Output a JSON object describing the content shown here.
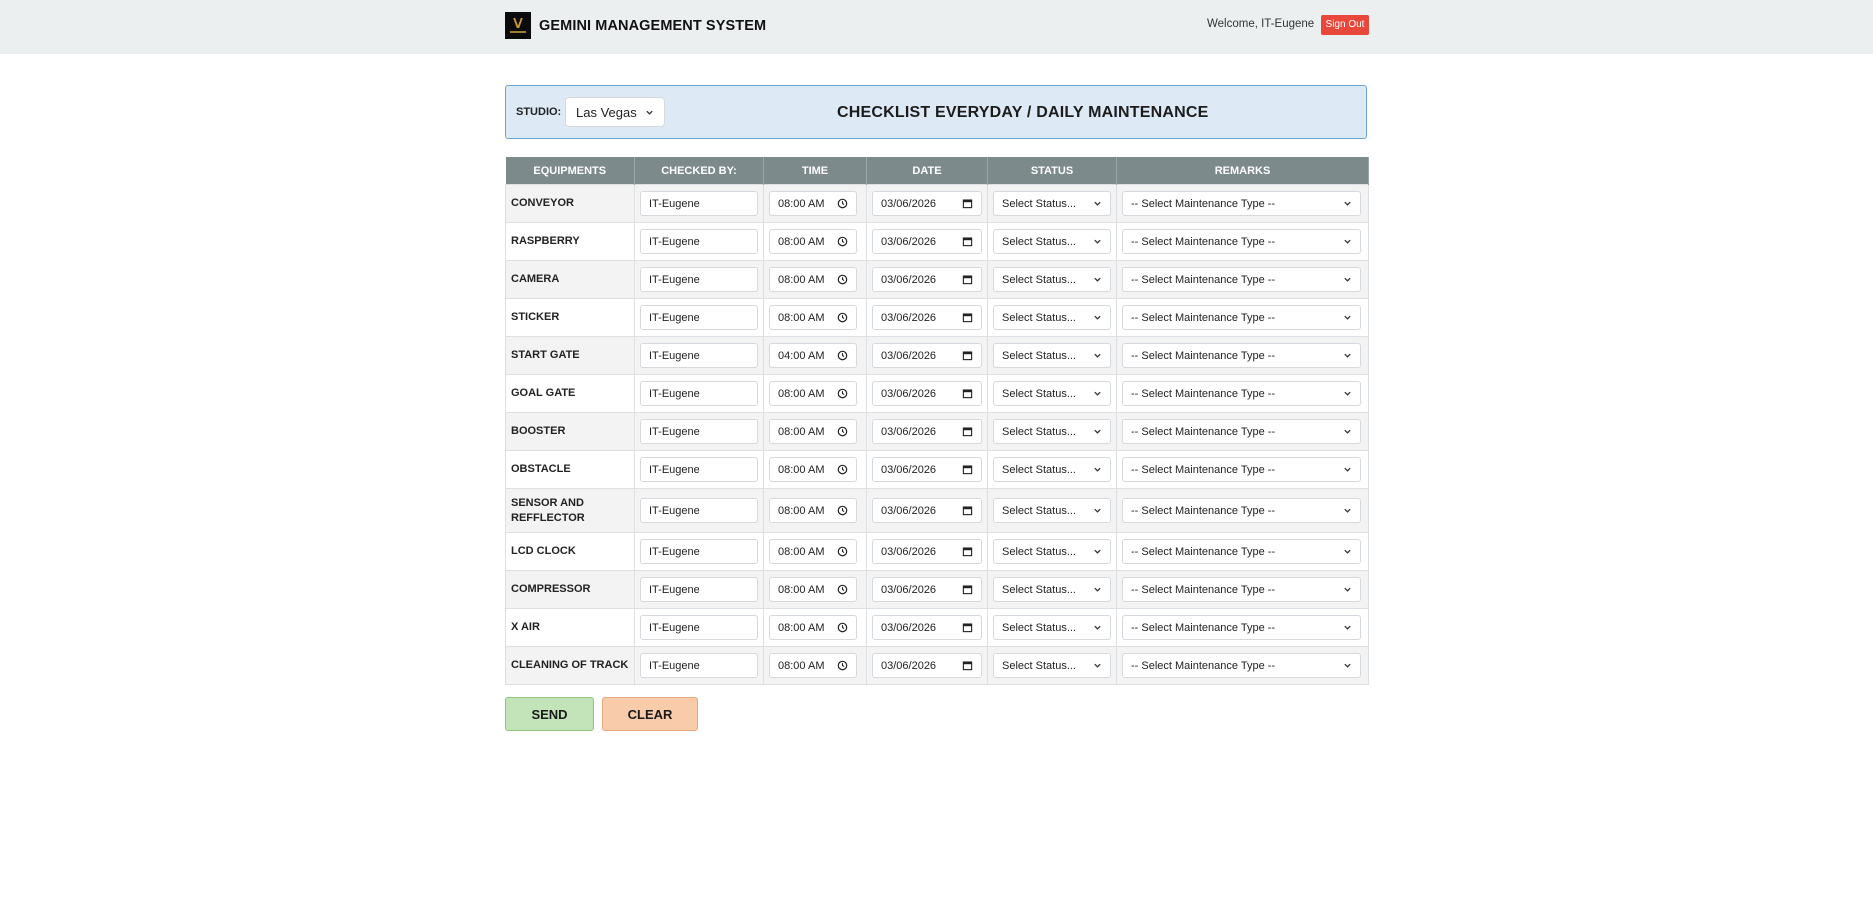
{
  "header": {
    "brand_title": "GEMINI MANAGEMENT SYSTEM",
    "welcome": "Welcome, IT-Eugene",
    "signout_label": "Sign Out",
    "logo_icon": "gemini-logo-icon"
  },
  "studio": {
    "label": "STUDIO:",
    "selected": "Las Vegas",
    "title": "CHECKLIST EVERYDAY / DAILY MAINTENANCE"
  },
  "table": {
    "columns": [
      "EQUIPMENTS",
      "CHECKED BY:",
      "TIME",
      "DATE",
      "STATUS",
      "REMARKS"
    ],
    "rows": [
      {
        "equipment": "CONVEYOR",
        "checked_by": "IT-Eugene",
        "time": "08:00 AM",
        "date": "03/06/2026",
        "status": "Select Status...",
        "remarks": "-- Select Maintenance Type --"
      },
      {
        "equipment": "RASPBERRY",
        "checked_by": "IT-Eugene",
        "time": "08:00 AM",
        "date": "03/06/2026",
        "status": "Select Status...",
        "remarks": "-- Select Maintenance Type --"
      },
      {
        "equipment": "CAMERA",
        "checked_by": "IT-Eugene",
        "time": "08:00 AM",
        "date": "03/06/2026",
        "status": "Select Status...",
        "remarks": "-- Select Maintenance Type --"
      },
      {
        "equipment": "STICKER",
        "checked_by": "IT-Eugene",
        "time": "08:00 AM",
        "date": "03/06/2026",
        "status": "Select Status...",
        "remarks": "-- Select Maintenance Type --"
      },
      {
        "equipment": "START GATE",
        "checked_by": "IT-Eugene",
        "time": "04:00 AM",
        "date": "03/06/2026",
        "status": "Select Status...",
        "remarks": "-- Select Maintenance Type --"
      },
      {
        "equipment": "GOAL GATE",
        "checked_by": "IT-Eugene",
        "time": "08:00 AM",
        "date": "03/06/2026",
        "status": "Select Status...",
        "remarks": "-- Select Maintenance Type --"
      },
      {
        "equipment": "BOOSTER",
        "checked_by": "IT-Eugene",
        "time": "08:00 AM",
        "date": "03/06/2026",
        "status": "Select Status...",
        "remarks": "-- Select Maintenance Type --"
      },
      {
        "equipment": "OBSTACLE",
        "checked_by": "IT-Eugene",
        "time": "08:00 AM",
        "date": "03/06/2026",
        "status": "Select Status...",
        "remarks": "-- Select Maintenance Type --"
      },
      {
        "equipment": "SENSOR AND REFFLECTOR",
        "checked_by": "IT-Eugene",
        "time": "08:00 AM",
        "date": "03/06/2026",
        "status": "Select Status...",
        "remarks": "-- Select Maintenance Type --"
      },
      {
        "equipment": "LCD CLOCK",
        "checked_by": "IT-Eugene",
        "time": "08:00 AM",
        "date": "03/06/2026",
        "status": "Select Status...",
        "remarks": "-- Select Maintenance Type --"
      },
      {
        "equipment": "COMPRESSOR",
        "checked_by": "IT-Eugene",
        "time": "08:00 AM",
        "date": "03/06/2026",
        "status": "Select Status...",
        "remarks": "-- Select Maintenance Type --"
      },
      {
        "equipment": "X AIR",
        "checked_by": "IT-Eugene",
        "time": "08:00 AM",
        "date": "03/06/2026",
        "status": "Select Status...",
        "remarks": "-- Select Maintenance Type --"
      },
      {
        "equipment": "CLEANING OF TRACK",
        "checked_by": "IT-Eugene",
        "time": "08:00 AM",
        "date": "03/06/2026",
        "status": "Select Status...",
        "remarks": "-- Select Maintenance Type --"
      }
    ]
  },
  "actions": {
    "send_label": "SEND",
    "clear_label": "CLEAR"
  },
  "colors": {
    "header_bg": "#eceff0",
    "signout": "#e8473b",
    "panel_bg": "#dde9f5",
    "panel_border": "#6fa2d6",
    "table_header": "#7d8a8b",
    "send": "#c3e3b9",
    "clear": "#f8cbab"
  }
}
